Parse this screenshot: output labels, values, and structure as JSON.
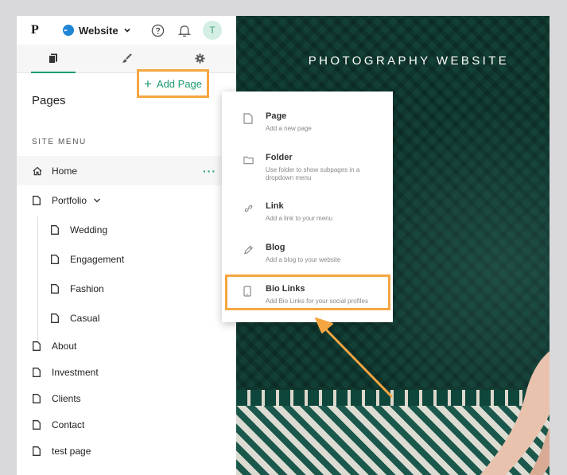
{
  "topbar": {
    "brand": "P",
    "site_name": "Website",
    "avatar_initial": "T"
  },
  "pages": {
    "title": "Pages",
    "add_label": "Add Page",
    "add_symbol": "+",
    "section_label": "SITE MENU",
    "more_symbol": "···",
    "items": [
      {
        "label": "Home"
      },
      {
        "label": "Portfolio"
      },
      {
        "label": "Wedding"
      },
      {
        "label": "Engagement"
      },
      {
        "label": "Fashion"
      },
      {
        "label": "Casual"
      },
      {
        "label": "About"
      },
      {
        "label": "Investment"
      },
      {
        "label": "Clients"
      },
      {
        "label": "Contact"
      },
      {
        "label": "test page"
      }
    ]
  },
  "preview": {
    "site_title": "PHOTOGRAPHY WEBSITE"
  },
  "add_menu": {
    "items": [
      {
        "title": "Page",
        "desc": "Add a new page"
      },
      {
        "title": "Folder",
        "desc": "Use folder to show subpages in a dropdown menu"
      },
      {
        "title": "Link",
        "desc": "Add a link to your menu"
      },
      {
        "title": "Blog",
        "desc": "Add a blog to your website"
      },
      {
        "title": "Bio Links",
        "desc": "Add Bio Links for your social profiles"
      }
    ]
  },
  "colors": {
    "accent": "#1c9a72",
    "highlight": "#f5a640",
    "preview_bg": "#123f36"
  }
}
